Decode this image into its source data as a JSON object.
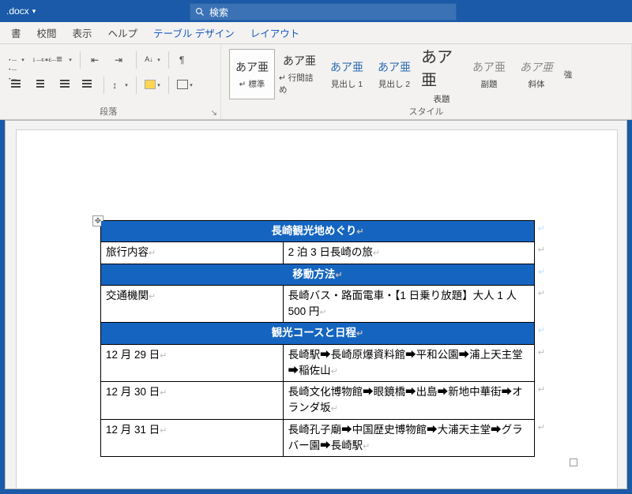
{
  "title": {
    "filename": ".docx"
  },
  "search": {
    "placeholder": "検索"
  },
  "menu": {
    "items": [
      "書",
      "校閲",
      "表示",
      "ヘルプ",
      "テーブル デザイン",
      "レイアウト"
    ]
  },
  "ribbon": {
    "paragraph_group_label": "段落",
    "styles_group_label": "スタイル",
    "styles": [
      {
        "sample": "あア亜",
        "label": "↵ 標準",
        "selected": true
      },
      {
        "sample": "あア亜",
        "label": "↵ 行間詰め"
      },
      {
        "sample": "あア亜",
        "label": "見出し 1"
      },
      {
        "sample": "あア亜",
        "label": "見出し 2"
      },
      {
        "sample": "あア亜",
        "label": "表題",
        "big": true
      },
      {
        "sample": "あア亜",
        "label": "副題"
      },
      {
        "sample": "あア亜",
        "label": "斜体",
        "italic": true
      },
      {
        "sample": "",
        "label": "強"
      }
    ]
  },
  "doc": {
    "h1": "長崎観光地めぐり",
    "row1": {
      "left": "旅行内容",
      "right": "2 泊 3 日長崎の旅"
    },
    "h2": "移動方法",
    "row2": {
      "left": "交通機関",
      "right": "長崎バス・路面電車・【1 日乗り放題】大人 1 人 500 円"
    },
    "h3": "観光コースと日程",
    "day1": {
      "date": "12 月 29 日",
      "route": "長崎駅➡長崎原爆資料館➡平和公園➡浦上天主堂➡稲佐山"
    },
    "day2": {
      "date": "12 月 30 日",
      "route": "長崎文化博物館➡眼鏡橋➡出島➡新地中華街➡オランダ坂"
    },
    "day3": {
      "date": "12 月 31 日",
      "route": "長崎孔子廟➡中国歴史博物館➡大浦天主堂➡グラバー園➡長崎駅"
    }
  }
}
